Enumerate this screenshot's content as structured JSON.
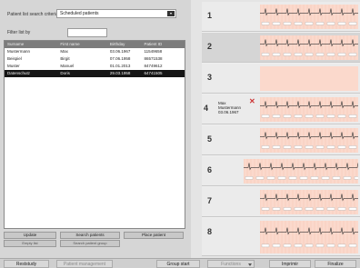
{
  "search": {
    "criteria_label": "Patient list search criteria",
    "criteria_value": "Scheduled patients",
    "filter_label": "Filter list by"
  },
  "table": {
    "headers": [
      "Surname",
      "First name",
      "Birthday",
      "Patient ID"
    ],
    "rows": [
      [
        "Mustermann",
        "Max",
        "03.06.1967",
        "11549658"
      ],
      [
        "Beispiel",
        "Birgit",
        "07.06.1958",
        "86571538"
      ],
      [
        "Muster",
        "Manuel",
        "01.01.2013",
        "84749612"
      ],
      [
        "Datenschutz",
        "Doris",
        "29.03.1958",
        "64741505"
      ]
    ],
    "selected_row": 3
  },
  "left_buttons": {
    "update": "Update",
    "empty_list": "Empty list",
    "search_patients": "Search patients",
    "search_patient_group": "Search patient group",
    "place_patient": "Place patient"
  },
  "slots": [
    {
      "number": "1"
    },
    {
      "number": "2"
    },
    {
      "number": "3"
    },
    {
      "number": "4",
      "patient_first": "Max",
      "patient_last": "Mustermann",
      "patient_dob": "03.06.1967"
    },
    {
      "number": "5"
    },
    {
      "number": "6"
    },
    {
      "number": "7"
    },
    {
      "number": "8"
    }
  ],
  "bottom_bar": {
    "reset": "Reststudy",
    "patient_management": "Patient management",
    "group_start": "Group start",
    "functions": "Functions",
    "print": "Imprimir",
    "finalize": "Finalize"
  }
}
